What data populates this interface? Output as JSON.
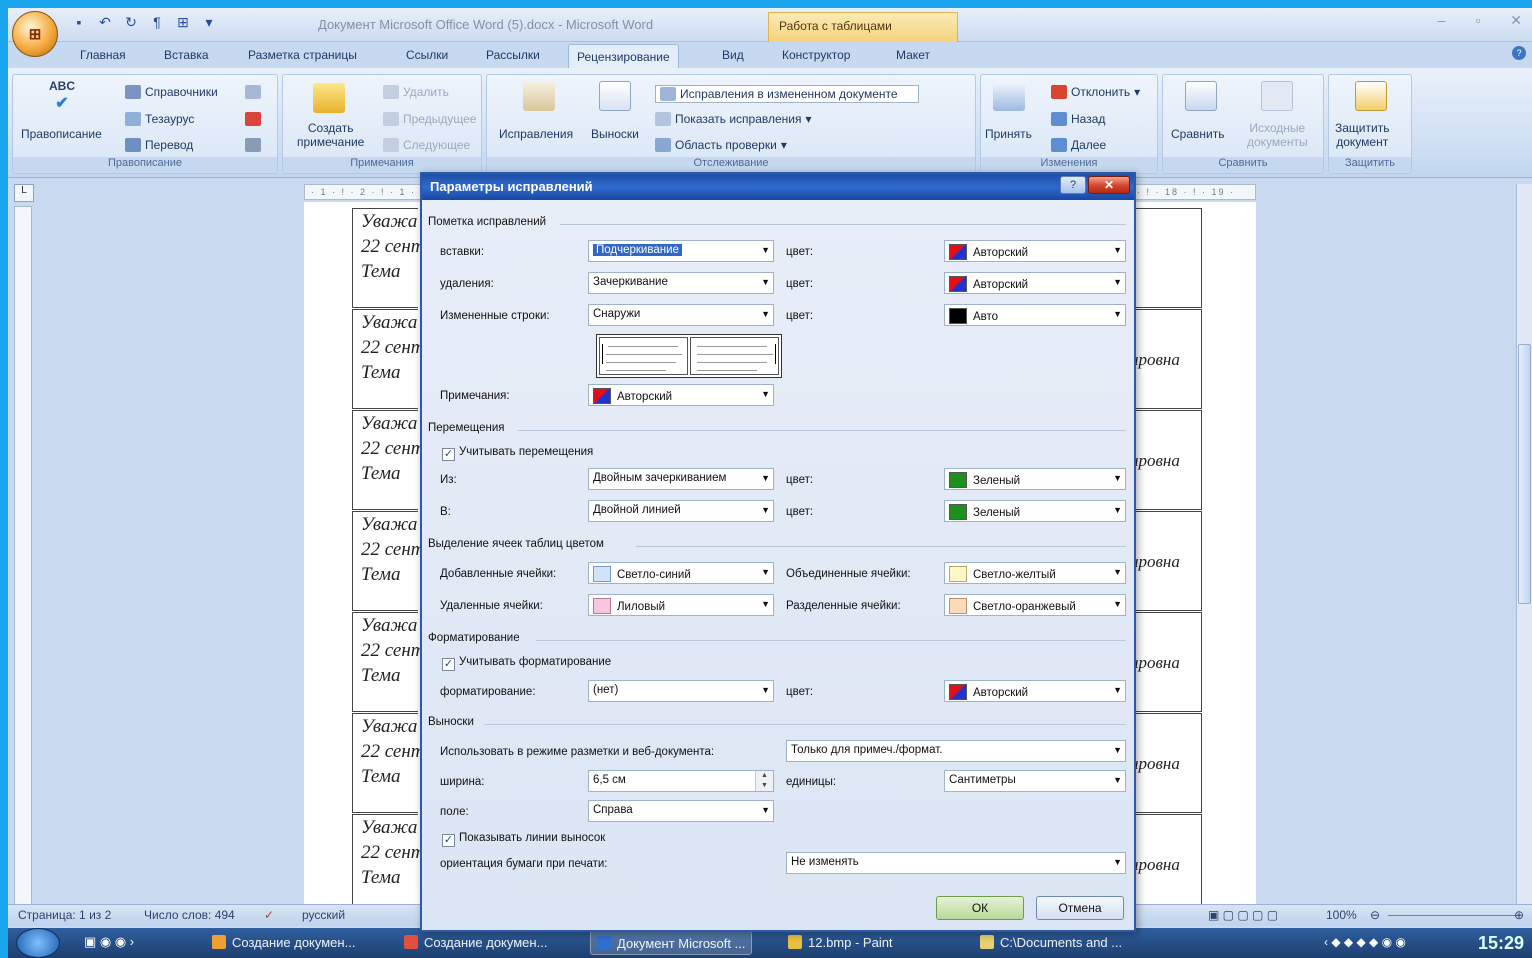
{
  "window": {
    "title": "Документ Microsoft Office Word (5).docx - Microsoft Word",
    "context_tab_title": "Работа с таблицами",
    "office_button": "Office",
    "window_controls": [
      "–",
      "▫",
      "✕"
    ]
  },
  "tabs": [
    "Главная",
    "Вставка",
    "Разметка страницы",
    "Ссылки",
    "Рассылки",
    "Рецензирование",
    "Вид",
    "Конструктор",
    "Макет"
  ],
  "active_tab": "Рецензирование",
  "ribbon": {
    "proofing": {
      "spelling": "Правописание",
      "abc": "ABC",
      "research": "Справочники",
      "thesaurus": "Тезаурус",
      "translate": "Перевод",
      "group": "Правописание"
    },
    "comments": {
      "new_line1": "Создать",
      "new_line2": "примечание",
      "delete": "Удалить",
      "previous": "Предыдущее",
      "next": "Следующее",
      "group": "Примечания"
    },
    "tracking": {
      "track": "Исправления",
      "balloons": "Выноски",
      "display": "Исправления в измененном документе",
      "show_markup": "Показать исправления",
      "reviewing_pane": "Область проверки",
      "group": "Отслеживание"
    },
    "changes": {
      "accept": "Принять",
      "reject": "Отклонить",
      "previous": "Назад",
      "next": "Далее",
      "group": "Изменения"
    },
    "compare": {
      "compare": "Сравнить",
      "show_source_line1": "Исходные",
      "show_source_line2": "документы",
      "group": "Сравнить"
    },
    "protect": {
      "protect_line1": "Защитить",
      "protect_line2": "документ",
      "group": "Защитить"
    }
  },
  "ruler": {
    "top_left": "· 1 · ! · 2 · ! · 1 ·",
    "top_right": "· ! · 18 · ! · 19 ·",
    "tab_button": "L"
  },
  "document": {
    "rows": [
      {
        "l1": "Уважа",
        "l2": "22 сент",
        "l3": "Тема",
        "right": ""
      },
      {
        "l1": "Уважа",
        "l2": "22 сент",
        "l3": "Тема",
        "right": "ировна"
      },
      {
        "l1": "Уважа",
        "l2": "22 сент",
        "l3": "Тема",
        "right": "ировна"
      },
      {
        "l1": "Уважа",
        "l2": "22 сент",
        "l3": "Тема",
        "right": "ировна"
      },
      {
        "l1": "Уважа",
        "l2": "22 сент",
        "l3": "Тема",
        "right": "ировна"
      },
      {
        "l1": "Уважа",
        "l2": "22 сент",
        "l3": "Тема",
        "right": "ировна"
      },
      {
        "l1": "Уважа",
        "l2": "22 сент",
        "l3": "Тема",
        "right": "ировна"
      }
    ]
  },
  "dialog": {
    "title": "Параметры исправлений",
    "help": "?",
    "close": "✕",
    "markup": {
      "section": "Пометка исправлений",
      "insertions_label": "вставки:",
      "insertions_value": "Подчеркивание",
      "insertions_color_label": "цвет:",
      "insertions_color_value": "Авторский",
      "deletions_label": "удаления:",
      "deletions_value": "Зачеркивание",
      "deletions_color_label": "цвет:",
      "deletions_color_value": "Авторский",
      "changed_lines_label": "Измененные строки:",
      "changed_lines_value": "Снаружи",
      "changed_lines_color_label": "цвет:",
      "changed_lines_color_value": "Авто",
      "comments_label": "Примечания:",
      "comments_value": "Авторский"
    },
    "moves": {
      "section": "Перемещения",
      "track_moves": "Учитывать перемещения",
      "from_label": "Из:",
      "from_value": "Двойным зачеркиванием",
      "from_color_label": "цвет:",
      "from_color_value": "Зеленый",
      "to_label": "В:",
      "to_value": "Двойной линией",
      "to_color_label": "цвет:",
      "to_color_value": "Зеленый"
    },
    "table_cells": {
      "section": "Выделение ячеек таблиц цветом",
      "inserted_label": "Добавленные ячейки:",
      "inserted_value": "Светло-синий",
      "merged_label": "Объединенные ячейки:",
      "merged_value": "Светло-желтый",
      "deleted_label": "Удаленные ячейки:",
      "deleted_value": "Лиловый",
      "split_label": "Разделенные ячейки:",
      "split_value": "Светло-оранжевый"
    },
    "formatting": {
      "section": "Форматирование",
      "track_formatting": "Учитывать форматирование",
      "formatting_label": "форматирование:",
      "formatting_value": "(нет)",
      "color_label": "цвет:",
      "color_value": "Авторский"
    },
    "balloons": {
      "section": "Выноски",
      "use_label": "Использовать в режиме разметки и веб-документа:",
      "use_value": "Только для примеч./формат.",
      "width_label": "ширина:",
      "width_value": "6,5 см",
      "units_label": "единицы:",
      "units_value": "Сантиметры",
      "margin_label": "поле:",
      "margin_value": "Справа",
      "show_lines": "Показывать линии выносок",
      "orientation_label": "ориентация бумаги при печати:",
      "orientation_value": "Не изменять"
    },
    "ok": "ОК",
    "cancel": "Отмена"
  },
  "status_bar": {
    "page": "Страница: 1 из 2",
    "words": "Число слов: 494",
    "language": "русский",
    "zoom": "100%"
  },
  "taskbar": {
    "items": [
      "Создание докумен...",
      "Создание докумен...",
      "Документ Microsoft ...",
      "12.bmp - Paint",
      "C:\\Documents and ..."
    ],
    "clock": "15:29"
  },
  "colors": {
    "author": "#2233cc",
    "author_red": "#e0101a",
    "auto": "#000000",
    "green": "#1f8f1f",
    "light_blue": "#cfe3fb",
    "light_yellow": "#fdf6c8",
    "lilac": "#f6c7e0",
    "light_orange": "#fbdcb8",
    "accent": "#2e6ad0"
  }
}
